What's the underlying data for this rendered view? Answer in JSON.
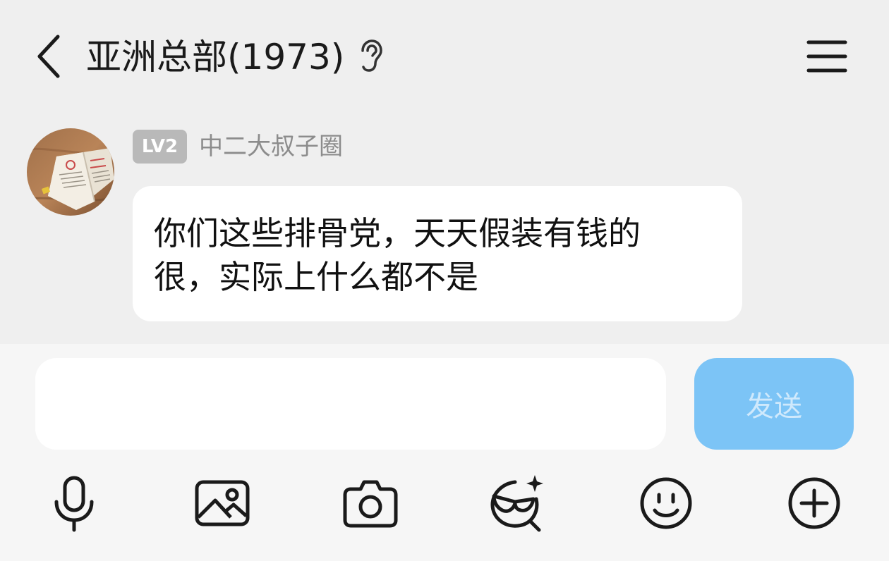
{
  "header": {
    "back_icon": "chevron-left-icon",
    "title": "亚洲总部(1973)",
    "ear_icon": "ear-icon",
    "menu_icon": "menu-icon"
  },
  "message": {
    "avatar": "avatar-book-photo",
    "level": "LV2",
    "sender": "中二大叔子圈",
    "text": "你们这些排骨党，天天假装有钱的很，实际上什么都不是"
  },
  "composer": {
    "input_value": "",
    "send_label": "发送",
    "send_color": "#7cc4f6",
    "tools": [
      "microphone-icon",
      "image-icon",
      "camera-icon",
      "mask-sparkle-icon",
      "emoji-icon",
      "plus-circle-icon"
    ]
  }
}
